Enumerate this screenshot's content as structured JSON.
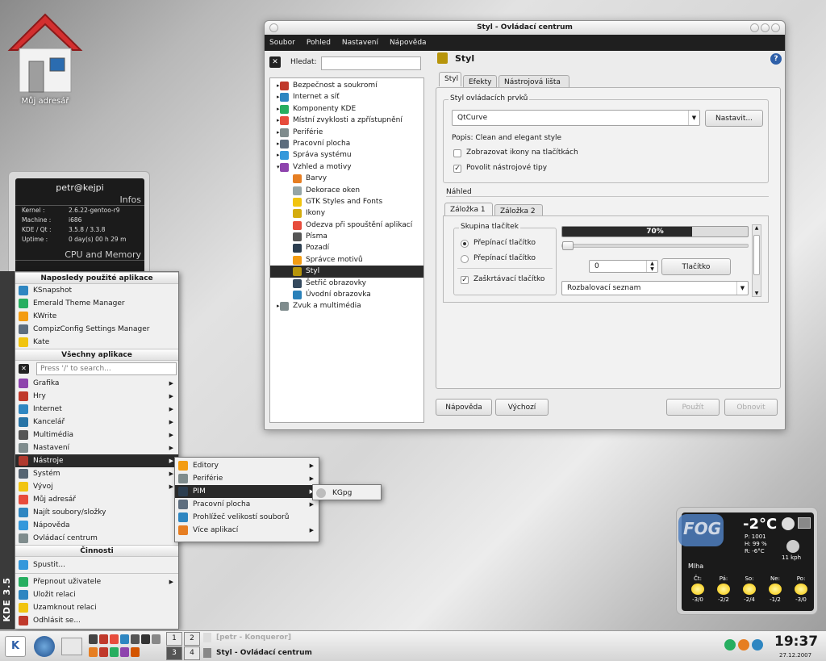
{
  "desktop": {
    "home_label": "Můj adresář"
  },
  "sysinfo": {
    "user": "petr@kejpi",
    "infos_title": "Infos",
    "rows": [
      {
        "k": "Kernel :",
        "v": "2.6.22-gentoo-r9"
      },
      {
        "k": "Machine :",
        "v": "i686"
      },
      {
        "k": "KDE / Qt :",
        "v": "3.5.8    /    3.3.8"
      },
      {
        "k": "Uptime :",
        "v": "0 day(s)  00 h 29 m"
      }
    ],
    "cpu_title": "CPU and Memory"
  },
  "window": {
    "title": "Styl - Ovládací centrum",
    "menu": [
      "Soubor",
      "Pohled",
      "Nastavení",
      "Nápověda"
    ],
    "search_label": "Hledat:",
    "tree": [
      {
        "label": "Bezpečnost a soukromí",
        "level": 0,
        "arrow": "▸",
        "color": "#c0392b"
      },
      {
        "label": "Internet a síť",
        "level": 0,
        "arrow": "▸",
        "color": "#2e86c1"
      },
      {
        "label": "Komponenty KDE",
        "level": 0,
        "arrow": "▸",
        "color": "#27ae60"
      },
      {
        "label": "Místní zvyklosti a zpřístupnění",
        "level": 0,
        "arrow": "▸",
        "color": "#e74c3c"
      },
      {
        "label": "Periférie",
        "level": 0,
        "arrow": "▸",
        "color": "#7f8c8d"
      },
      {
        "label": "Pracovní plocha",
        "level": 0,
        "arrow": "▸",
        "color": "#5d6d7e"
      },
      {
        "label": "Správa systému",
        "level": 0,
        "arrow": "▸",
        "color": "#3498db"
      },
      {
        "label": "Vzhled a motivy",
        "level": 0,
        "arrow": "▾",
        "color": "#8e44ad"
      },
      {
        "label": "Barvy",
        "level": 1,
        "arrow": "",
        "color": "#e67e22"
      },
      {
        "label": "Dekorace oken",
        "level": 1,
        "arrow": "",
        "color": "#95a5a6"
      },
      {
        "label": "GTK Styles and Fonts",
        "level": 1,
        "arrow": "",
        "color": "#f1c40f"
      },
      {
        "label": "Ikony",
        "level": 1,
        "arrow": "",
        "color": "#d4ac0d"
      },
      {
        "label": "Odezva při spouštění aplikací",
        "level": 1,
        "arrow": "",
        "color": "#e74c3c"
      },
      {
        "label": "Písma",
        "level": 1,
        "arrow": "",
        "color": "#555555"
      },
      {
        "label": "Pozadí",
        "level": 1,
        "arrow": "",
        "color": "#2c3e50"
      },
      {
        "label": "Správce motivů",
        "level": 1,
        "arrow": "",
        "color": "#f39c12"
      },
      {
        "label": "Styl",
        "level": 1,
        "arrow": "",
        "color": "#b7950b",
        "selected": true
      },
      {
        "label": "Šetřič obrazovky",
        "level": 1,
        "arrow": "",
        "color": "#34495e"
      },
      {
        "label": "Úvodní obrazovka",
        "level": 1,
        "arrow": "",
        "color": "#2980b9"
      },
      {
        "label": "Zvuk a multimédia",
        "level": 0,
        "arrow": "▸",
        "color": "#7f8c8d"
      }
    ],
    "page_title": "Styl",
    "tabs": [
      "Styl",
      "Efekty",
      "Nástrojová lišta"
    ],
    "widget_group": "Styl ovládacích prvků",
    "style_value": "QtCurve",
    "configure_btn": "Nastavit...",
    "description": "Popis: Clean and elegant style",
    "cb_icons": "Zobrazovat ikony na tlačítkách",
    "cb_tooltips": "Povolit nástrojové tipy",
    "preview_label": "Náhled",
    "preview_tabs": [
      "Záložka 1",
      "Záložka 2"
    ],
    "btn_group": "Skupina tlačítek",
    "radio1": "Přepínací tlačítko",
    "radio2": "Přepínací tlačítko",
    "checkbox": "Zaškrtávací tlačítko",
    "progress": 0.7,
    "progress_text": "70%",
    "spin_value": "0",
    "button_label": "Tlačítko",
    "combo_label": "Rozbalovací seznam",
    "help_btn": "Nápověda",
    "default_btn": "Výchozí",
    "apply_btn": "Použít",
    "reset_btn": "Obnovit"
  },
  "kmenu": {
    "side_label": "KDE 3.5",
    "recent_title": "Naposledy použité aplikace",
    "recent": [
      {
        "label": "KSnapshot",
        "color": "#2e86c1"
      },
      {
        "label": "Emerald Theme Manager",
        "color": "#27ae60"
      },
      {
        "label": "KWrite",
        "color": "#f39c12"
      },
      {
        "label": "CompizConfig Settings Manager",
        "color": "#5d6d7e"
      },
      {
        "label": "Kate",
        "color": "#f1c40f"
      }
    ],
    "all_title": "Všechny aplikace",
    "search_placeholder": "Press '/' to search...",
    "apps": [
      {
        "label": "Grafika",
        "color": "#8e44ad",
        "sub": true
      },
      {
        "label": "Hry",
        "color": "#c0392b",
        "sub": true
      },
      {
        "label": "Internet",
        "color": "#2e86c1",
        "sub": true
      },
      {
        "label": "Kancelář",
        "color": "#2874a6",
        "sub": true
      },
      {
        "label": "Multimédia",
        "color": "#555555",
        "sub": true
      },
      {
        "label": "Nastavení",
        "color": "#7f8c8d",
        "sub": true
      },
      {
        "label": "Nástroje",
        "color": "#b03a2e",
        "sub": true,
        "selected": true
      },
      {
        "label": "Systém",
        "color": "#566573",
        "sub": true
      },
      {
        "label": "Vývoj",
        "color": "#f1c40f",
        "sub": true
      },
      {
        "label": "Můj adresář",
        "color": "#e74c3c",
        "sub": false
      },
      {
        "label": "Najít soubory/složky",
        "color": "#2e86c1",
        "sub": false
      },
      {
        "label": "Nápověda",
        "color": "#3498db",
        "sub": false
      },
      {
        "label": "Ovládací centrum",
        "color": "#7f8c8d",
        "sub": false
      }
    ],
    "actions_title": "Činnosti",
    "run": "Spustit...",
    "session": [
      {
        "label": "Přepnout uživatele",
        "color": "#27ae60",
        "sub": true
      },
      {
        "label": "Uložit relaci",
        "color": "#2e86c1",
        "sub": false
      },
      {
        "label": "Uzamknout relaci",
        "color": "#f1c40f",
        "sub": false
      },
      {
        "label": "Odhlásit se...",
        "color": "#c0392b",
        "sub": false
      }
    ]
  },
  "tools_menu": [
    {
      "label": "Editory",
      "color": "#f39c12",
      "sub": true
    },
    {
      "label": "Periférie",
      "color": "#7f8c8d",
      "sub": true
    },
    {
      "label": "PIM",
      "color": "#2c3e50",
      "sub": true,
      "selected": true
    },
    {
      "label": "Pracovní plocha",
      "color": "#5d6d7e",
      "sub": true
    },
    {
      "label": "Prohlížeč velikostí souborů",
      "color": "#2e86c1",
      "sub": false
    },
    {
      "label": "Více aplikací",
      "color": "#e67e22",
      "sub": true
    }
  ],
  "pim_menu": {
    "label": "KGpg"
  },
  "weather": {
    "badge": "FOG",
    "temp": "-2°C",
    "p": "P:  1001",
    "h": "H:  99 %",
    "r": "R:  -6°C",
    "wind": "11 kph",
    "condition": "Mlha",
    "days": [
      {
        "d": "Čt:",
        "t": "-3/0"
      },
      {
        "d": "Pá:",
        "t": "-2/2"
      },
      {
        "d": "So:",
        "t": "-2/4"
      },
      {
        "d": "Ne:",
        "t": "-1/2"
      },
      {
        "d": "Po:",
        "t": "-3/0"
      }
    ]
  },
  "taskbar": {
    "desktops": [
      "1",
      "2",
      "3",
      "4"
    ],
    "task1": "[petr - Konqueror]",
    "task2": "Styl - Ovládací centrum",
    "time": "19:37",
    "date": "27.12.2007"
  }
}
